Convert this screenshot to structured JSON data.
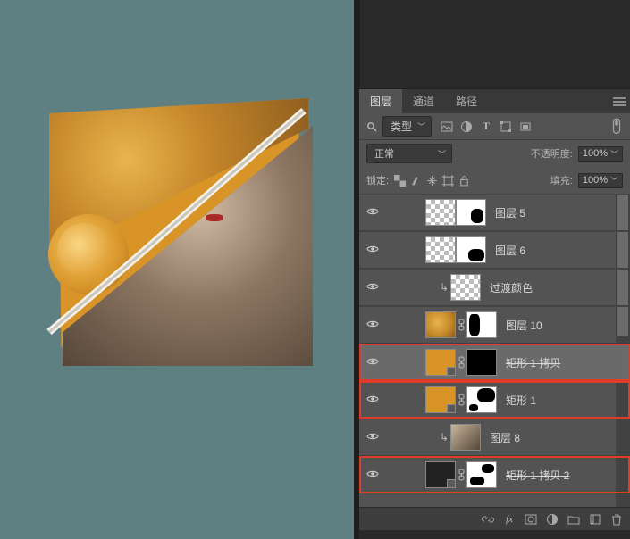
{
  "tabs": {
    "layers": "图层",
    "channels": "通道",
    "paths": "路径"
  },
  "filter": {
    "label": "类型"
  },
  "icons": {
    "image_layer": "image-layer-filter-icon",
    "adjustment": "adjustment-layer-filter-icon",
    "type": "type-layer-filter-icon",
    "shape": "shape-layer-filter-icon",
    "smart": "smart-object-filter-icon",
    "toggle": "filter-toggle-icon"
  },
  "blend": {
    "mode": "正常",
    "opacity_label": "不透明度:",
    "opacity": "100%"
  },
  "lock": {
    "label": "锁定:",
    "fill_label": "填充:",
    "fill": "100%"
  },
  "layers": [
    {
      "name": "图层 5",
      "thumb": "checker",
      "mask": "white-blot",
      "indent": 44
    },
    {
      "name": "图层 6",
      "thumb": "checker",
      "mask": "white-blot2",
      "indent": 44
    },
    {
      "name": "过渡颜色",
      "thumb": "checker",
      "clip": true,
      "indent": 58
    },
    {
      "name": "图层 10",
      "thumb": "photo1",
      "mask": "white-blot3",
      "link": true,
      "indent": 44
    },
    {
      "name": "矩形 1 拷贝",
      "thumb": "orange",
      "mask": "black",
      "link": true,
      "badge": true,
      "sel": true,
      "hl": true,
      "strike": true,
      "indent": 44
    },
    {
      "name": "矩形 1",
      "thumb": "orange",
      "mask": "white-blot4",
      "link": true,
      "badge": true,
      "hl": true,
      "indent": 44
    },
    {
      "name": "图层 8",
      "thumb": "photo2",
      "clip": true,
      "indent": 58
    },
    {
      "name": "矩形 1 拷贝 2",
      "thumb": "dark",
      "mask": "white-blot5",
      "link": true,
      "badge": true,
      "hl": true,
      "strike": true,
      "indent": 44
    }
  ],
  "footer": {
    "link": "link-icon",
    "fx": "fx-icon",
    "mask": "add-mask-icon",
    "adj": "adjustment-icon",
    "group": "group-icon",
    "new": "new-layer-icon",
    "trash": "trash-icon"
  }
}
